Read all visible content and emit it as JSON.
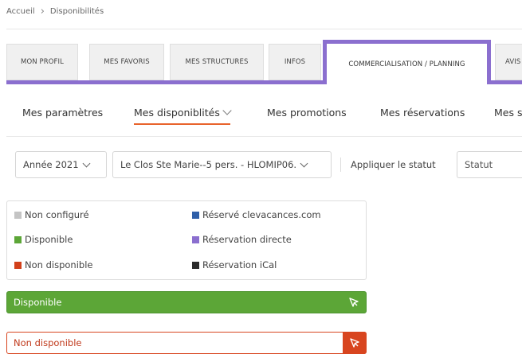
{
  "breadcrumb": {
    "home": "Accueil",
    "current": "Disponibilités"
  },
  "tabs": [
    {
      "label": "MON PROFIL"
    },
    {
      "label": "MES FAVORIS"
    },
    {
      "label": "MES STRUCTURES"
    },
    {
      "label": "INFOS"
    },
    {
      "label": "COMMERCIALISATION / PLANNING"
    },
    {
      "label": "AVIS"
    }
  ],
  "active_tab": "COMMERCIALISATION / PLANNING",
  "subnav": [
    {
      "label": "Mes paramètres"
    },
    {
      "label": "Mes disponiblités"
    },
    {
      "label": "Mes promotions"
    },
    {
      "label": "Mes réservations"
    },
    {
      "label": "Mes s"
    }
  ],
  "filters": {
    "year": "Année 2021",
    "property": "Le Clos Ste Marie--5 pers. - HLOMIP06.",
    "apply_label": "Appliquer le statut",
    "status_placeholder": "Statut"
  },
  "legend": [
    {
      "label": "Non configuré",
      "color": "#c4c4c4"
    },
    {
      "label": "Disponible",
      "color": "#5ca637"
    },
    {
      "label": "Non disponible",
      "color": "#d2401a"
    },
    {
      "label": "Réservé clevacances.com",
      "color": "#2f5fa8"
    },
    {
      "label": "Réservation directe",
      "color": "#8b6fcf"
    },
    {
      "label": "Réservation iCal",
      "color": "#2b2b2b"
    }
  ],
  "status_buttons": {
    "available": "Disponible",
    "unavailable": "Non disponible"
  },
  "colors": {
    "accent": "#8b6fcf",
    "active_underline": "#e8632b"
  }
}
